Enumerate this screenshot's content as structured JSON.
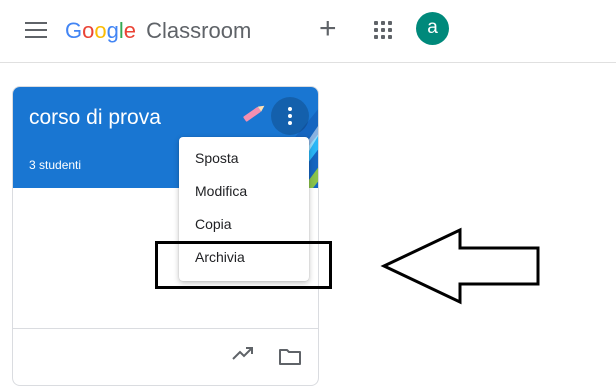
{
  "header": {
    "logo": {
      "letters": [
        "G",
        "o",
        "o",
        "g",
        "l",
        "e"
      ],
      "colors": [
        "#4285f4",
        "#ea4335",
        "#fbbc05",
        "#4285f4",
        "#34a853",
        "#ea4335"
      ],
      "product": "Classroom"
    },
    "plus_symbol": "+",
    "avatar_letter": "a",
    "avatar_color": "#00897b",
    "icons": {
      "menu": "menu-icon",
      "apps": "apps-icon",
      "add": "plus-icon"
    }
  },
  "course": {
    "title": "corso di prova",
    "students": "3 studenti",
    "header_color": "#1976d2"
  },
  "menu": {
    "items": [
      {
        "label": "Sposta"
      },
      {
        "label": "Modifica"
      },
      {
        "label": "Copia"
      },
      {
        "label": "Archivia"
      }
    ]
  },
  "annotation": {
    "highlighted_item": "Archivia",
    "arrow": "left-arrow-icon"
  }
}
